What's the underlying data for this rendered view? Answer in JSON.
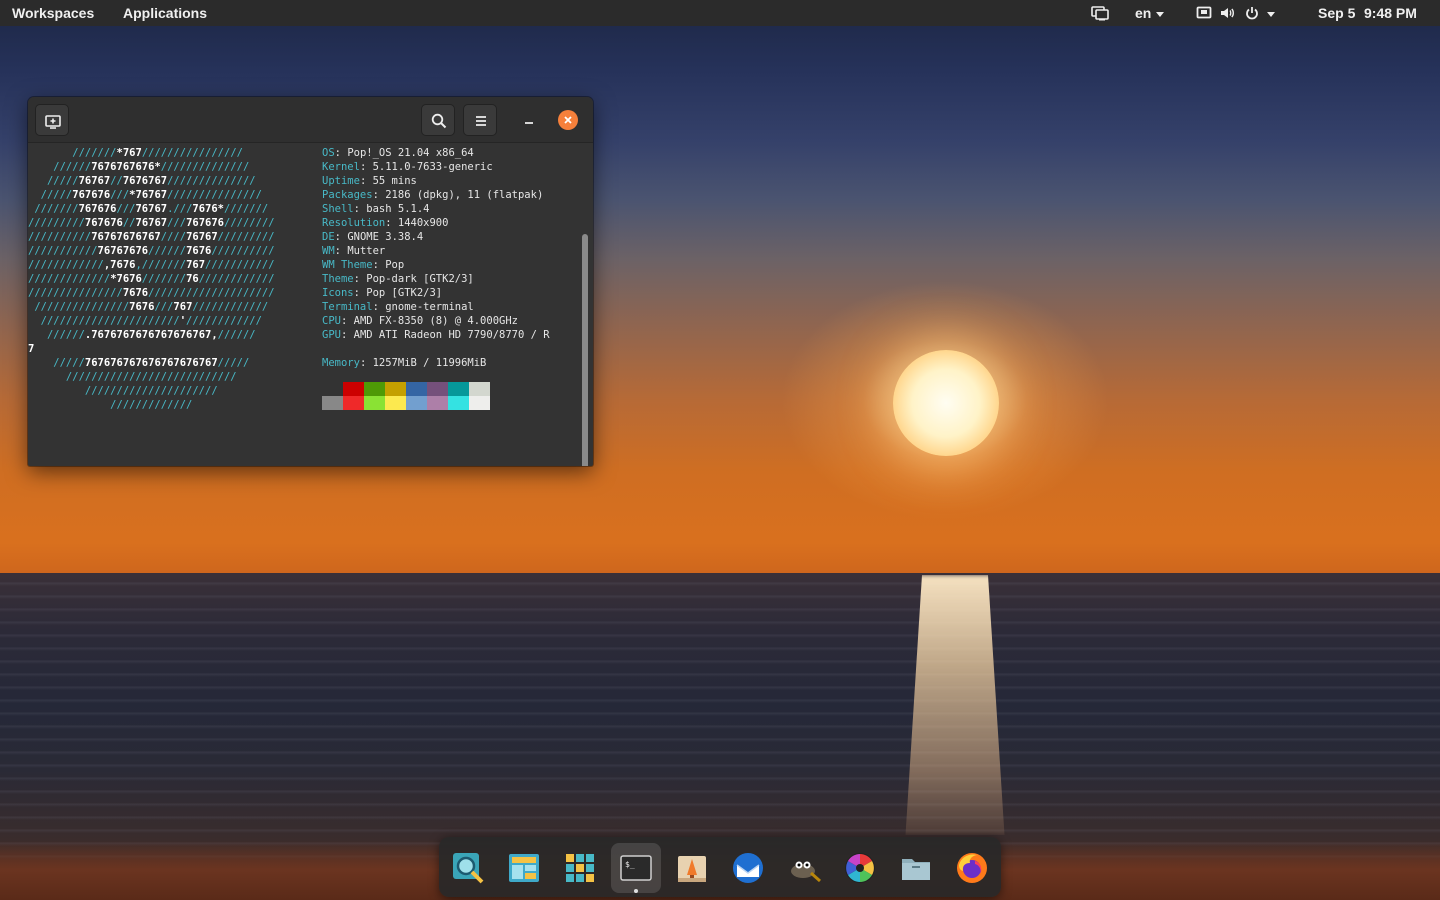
{
  "topbar": {
    "workspaces_label": "Workspaces",
    "applications_label": "Applications",
    "keyboard_layout": "en",
    "date": "Sep 5",
    "time": "9:48 PM"
  },
  "terminal": {
    "ascii_art": [
      [
        [
          "c",
          "       ///////"
        ],
        [
          "w",
          "*767"
        ],
        [
          "c",
          "////////////////"
        ]
      ],
      [
        [
          "c",
          "    //////"
        ],
        [
          "w",
          "7676767676*"
        ],
        [
          "c",
          "//////////////"
        ]
      ],
      [
        [
          "c",
          "   /////"
        ],
        [
          "w",
          "76767"
        ],
        [
          "c",
          "//"
        ],
        [
          "w",
          "7676767"
        ],
        [
          "c",
          "//////////////"
        ]
      ],
      [
        [
          "c",
          "  /////"
        ],
        [
          "w",
          "767676"
        ],
        [
          "c",
          "///"
        ],
        [
          "w",
          "*76767"
        ],
        [
          "c",
          "///////////////"
        ]
      ],
      [
        [
          "c",
          " ///////"
        ],
        [
          "w",
          "767676"
        ],
        [
          "c",
          "///"
        ],
        [
          "w",
          "76767"
        ],
        [
          "c",
          "."
        ],
        [
          "c",
          "///"
        ],
        [
          "w",
          "7676*"
        ],
        [
          "c",
          "///////"
        ]
      ],
      [
        [
          "c",
          "/////////"
        ],
        [
          "w",
          "767676"
        ],
        [
          "c",
          "//"
        ],
        [
          "w",
          "76767"
        ],
        [
          "c",
          "///"
        ],
        [
          "w",
          "767676"
        ],
        [
          "c",
          "////////"
        ]
      ],
      [
        [
          "c",
          "//////////"
        ],
        [
          "w",
          "76767676767"
        ],
        [
          "c",
          "////"
        ],
        [
          "w",
          "76767"
        ],
        [
          "c",
          "/////////"
        ]
      ],
      [
        [
          "c",
          "///////////"
        ],
        [
          "w",
          "76767676"
        ],
        [
          "c",
          "//////"
        ],
        [
          "w",
          "7676"
        ],
        [
          "c",
          "//////////"
        ]
      ],
      [
        [
          "c",
          "////////////"
        ],
        [
          "w",
          ",7676"
        ],
        [
          "c",
          ","
        ],
        [
          "c",
          "///////"
        ],
        [
          "w",
          "767"
        ],
        [
          "c",
          "///////////"
        ]
      ],
      [
        [
          "c",
          "/////////////"
        ],
        [
          "w",
          "*7676"
        ],
        [
          "c",
          "///////"
        ],
        [
          "w",
          "76"
        ],
        [
          "c",
          "////////////"
        ]
      ],
      [
        [
          "c",
          "///////////////"
        ],
        [
          "w",
          "7676"
        ],
        [
          "c",
          "////////////////////"
        ]
      ],
      [
        [
          "c",
          " ///////////////"
        ],
        [
          "w",
          "7676"
        ],
        [
          "c",
          "///"
        ],
        [
          "w",
          "767"
        ],
        [
          "c",
          "////////////"
        ]
      ],
      [
        [
          "c",
          "  //////////////////////"
        ],
        [
          "w",
          "'"
        ],
        [
          "c",
          "////////////"
        ]
      ],
      [
        [
          "c",
          "   //////"
        ],
        [
          "w",
          ".7676767676767676767,"
        ],
        [
          "c",
          "//////"
        ]
      ],
      [
        [
          "w",
          "7"
        ]
      ],
      [
        [
          "c",
          "    /////"
        ],
        [
          "w",
          "767676767676767676767"
        ],
        [
          "c",
          "/////"
        ]
      ],
      [
        [
          "c",
          "      ///////////////////////////"
        ]
      ],
      [
        [
          "c",
          "         /////////////////////"
        ]
      ],
      [
        [
          "c",
          "             /////////////"
        ]
      ]
    ],
    "info": [
      {
        "key": "OS",
        "value": "Pop!_OS 21.04 x86_64"
      },
      {
        "key": "Kernel",
        "value": "5.11.0-7633-generic"
      },
      {
        "key": "Uptime",
        "value": "55 mins"
      },
      {
        "key": "Packages",
        "value": "2186 (dpkg), 11 (flatpak)"
      },
      {
        "key": "Shell",
        "value": "bash 5.1.4"
      },
      {
        "key": "Resolution",
        "value": "1440x900"
      },
      {
        "key": "DE",
        "value": "GNOME 3.38.4"
      },
      {
        "key": "WM",
        "value": "Mutter"
      },
      {
        "key": "WM Theme",
        "value": "Pop"
      },
      {
        "key": "Theme",
        "value": "Pop-dark [GTK2/3]"
      },
      {
        "key": "Icons",
        "value": "Pop [GTK2/3]"
      },
      {
        "key": "Terminal",
        "value": "gnome-terminal"
      },
      {
        "key": "CPU",
        "value": "AMD FX-8350 (8) @ 4.000GHz"
      },
      {
        "key": "GPU",
        "value": "AMD ATI Radeon HD 7790/8770 / R"
      },
      {
        "key": "",
        "value": ""
      },
      {
        "key": "Memory",
        "value": "1257MiB / 11996MiB"
      }
    ],
    "palette_top": [
      "#333333",
      "#cc0000",
      "#4e9a06",
      "#c4a000",
      "#3465a4",
      "#75507b",
      "#06989a",
      "#d3d7cf"
    ],
    "palette_bottom": [
      "#888888",
      "#ef2929",
      "#8ae234",
      "#fce94f",
      "#729fcf",
      "#ad7fa8",
      "#34e2e2",
      "#eeeeec"
    ]
  },
  "colors": {
    "accent_cyan": "#48b9c7",
    "close_orange": "#f6803b",
    "topbar_bg": "#2b2b2b",
    "terminal_bg": "#333333"
  },
  "dock": {
    "items": [
      {
        "name": "search-app-icon"
      },
      {
        "name": "workspaces-icon"
      },
      {
        "name": "app-grid-icon"
      },
      {
        "name": "terminal-icon"
      },
      {
        "name": "pop-shop-icon"
      },
      {
        "name": "thunderbird-icon"
      },
      {
        "name": "gimp-icon"
      },
      {
        "name": "color-wheel-icon"
      },
      {
        "name": "files-icon"
      },
      {
        "name": "firefox-icon"
      }
    ]
  }
}
